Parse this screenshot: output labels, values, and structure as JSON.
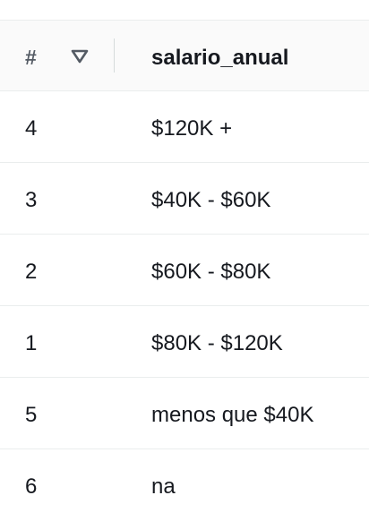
{
  "table": {
    "header": {
      "index_label": "#",
      "column_label": "salario_anual"
    },
    "rows": [
      {
        "index": "4",
        "value": "$120K +"
      },
      {
        "index": "3",
        "value": "$40K - $60K"
      },
      {
        "index": "2",
        "value": "$60K - $80K"
      },
      {
        "index": "1",
        "value": "$80K - $120K"
      },
      {
        "index": "5",
        "value": "menos que $40K"
      },
      {
        "index": "6",
        "value": "na"
      }
    ]
  },
  "icons": {
    "sort": "sort-descending-triangle-icon"
  },
  "colors": {
    "header_bg": "#fafafa",
    "border": "#eaeded",
    "text": "#16191f",
    "muted": "#545b64"
  }
}
